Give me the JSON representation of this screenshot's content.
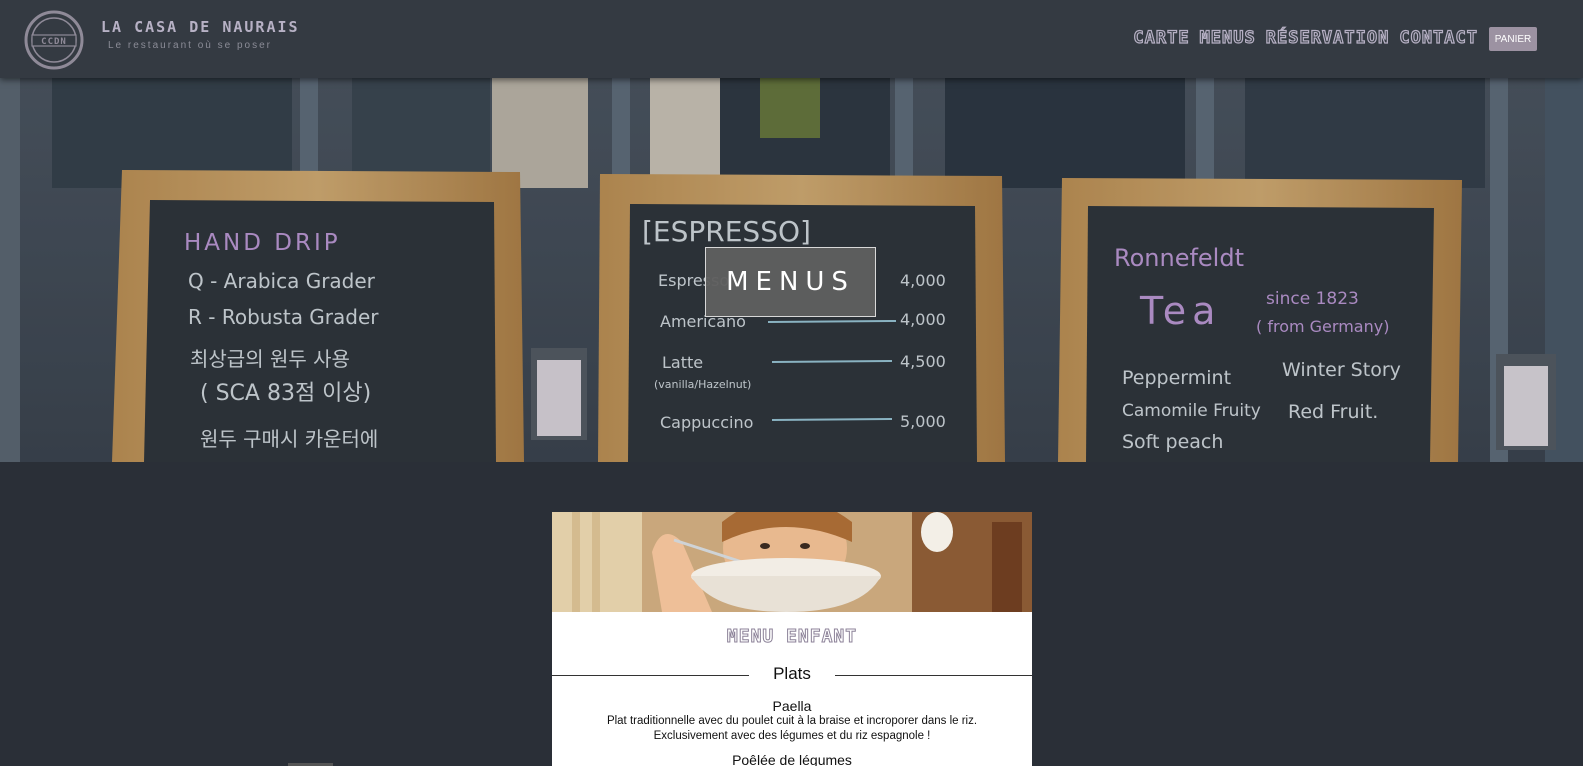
{
  "header": {
    "brand": "La Casa de Naurais",
    "tagline": "Le restaurant où se poser",
    "logo_text": "CCDN",
    "nav": [
      "Carte",
      "Menus",
      "Réservation",
      "Contact"
    ],
    "cart_label": "PANIER"
  },
  "hero": {
    "title": "MENUS",
    "boards": {
      "left": [
        "HAND DRIP",
        "Q - Arabica Grader",
        "R - Robusta Grader",
        "최상급의 원두 사용",
        "( SCA 83점 이상)",
        "원두 구매시 카운터에"
      ],
      "middle": {
        "heading": "[ESPRESSO]",
        "items": [
          {
            "name": "Espresso",
            "price": "4,000"
          },
          {
            "name": "Americano",
            "price": "4,000"
          },
          {
            "name": "Latte",
            "price": "4,500"
          },
          {
            "name": "Cappuccino",
            "price": "5,000"
          }
        ],
        "note": "(vanilla/Hazelnut)"
      },
      "right": [
        "Ronnefeldt",
        "Tea",
        "since 1823",
        "( from Germany)",
        "Peppermint",
        "Winter Story",
        "Camomile Fruity",
        "Red Fruit.",
        "Soft peach"
      ]
    }
  },
  "card": {
    "title": "Menu Enfant",
    "section": "Plats",
    "dish_name": "Paella",
    "dish_desc_1": "Plat traditionnelle avec du poulet cuit à la braise et incroporer dans le riz.",
    "dish_desc_2": "Exclusivement avec des légumes et du riz espagnole !",
    "next_dish": "Poêlée de légumes"
  },
  "colors": {
    "header_bg": "#343a42",
    "page_bg": "#2a2f37",
    "accent": "#b6b0c4",
    "cart_bg": "#9c92a2"
  }
}
